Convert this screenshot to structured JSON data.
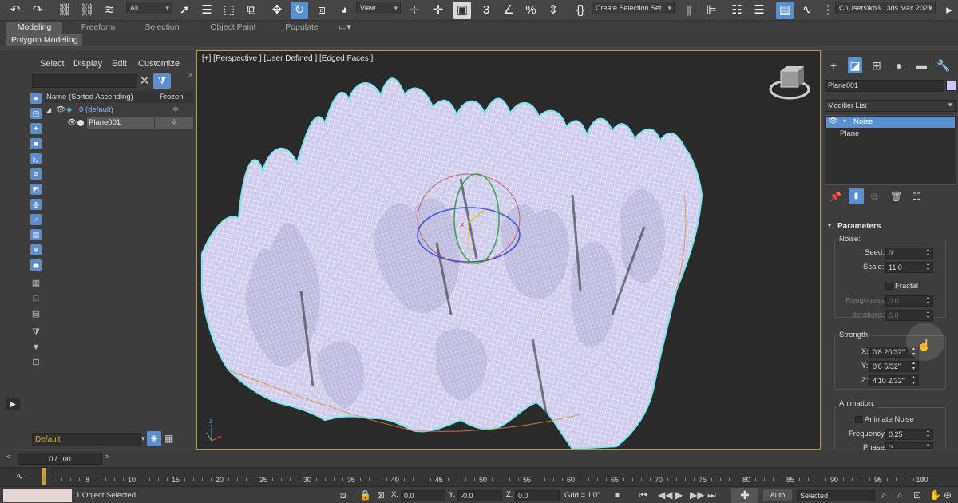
{
  "toolbar": {
    "selection_filter": "All",
    "ref_coord": "View",
    "named_selection": "Create Selection Set",
    "project_path": "C:\\Users\\kb3...3ds Max 2021"
  },
  "ribbon": {
    "tabs": [
      "Modeling",
      "Freeform",
      "Selection",
      "Object Paint",
      "Populate"
    ],
    "active_tab": "Modeling",
    "subtab": "Polygon Modeling"
  },
  "scene_explorer": {
    "menu": [
      "Select",
      "Display",
      "Edit",
      "Customize"
    ],
    "filter_value": "",
    "col_name": "Name (Sorted Ascending)",
    "col_frozen": "Frozen",
    "rows": [
      {
        "label": "0 (default)",
        "type": "layer"
      },
      {
        "label": "Plane001",
        "type": "object"
      }
    ],
    "layer_dropdown": "Default"
  },
  "viewport": {
    "label": "[+] [Perspective ] [User Defined ] [Edged Faces ]"
  },
  "command_panel": {
    "object_name": "Plane001",
    "object_color": "#c8c8ff",
    "modifier_list": "Modifier List",
    "stack": [
      "Noise",
      "Plane"
    ],
    "rollout_title": "Parameters",
    "noise_group": "Noise:",
    "seed_label": "Seed:",
    "seed": "0",
    "scale_label": "Scale:",
    "scale": "11.0",
    "fractal_label": "Fractal",
    "roughness_label": "Roughness:",
    "roughness": "0.0",
    "iterations_label": "Iterations:",
    "iterations": "6.0",
    "strength_group": "Strength:",
    "x_label": "X:",
    "x": "0'8 20/32\"",
    "y_label": "Y:",
    "y": "0'6 5/32\"",
    "z_label": "Z:",
    "z": "4'10 2/32\"",
    "animation_group": "Animation:",
    "animate_noise_label": "Animate Noise",
    "frequency_label": "Frequency:",
    "frequency": "0.25",
    "phase_label": "Phase:",
    "phase": "0"
  },
  "timeline": {
    "frame": "0 / 100",
    "ticks": [
      "0",
      "5",
      "10",
      "15",
      "20",
      "25",
      "30",
      "35",
      "40",
      "45",
      "50",
      "55",
      "60",
      "65",
      "70",
      "75",
      "80",
      "85",
      "90",
      "95",
      "100"
    ]
  },
  "status": {
    "message": "1 Object Selected",
    "x_label": "X:",
    "x": "0.0",
    "y_label": "Y:",
    "y": "-0.0",
    "z_label": "Z:",
    "z": "0.0",
    "grid": "Grid = 1'0\"",
    "key_mode": "Auto",
    "key_filter": "Selected"
  }
}
